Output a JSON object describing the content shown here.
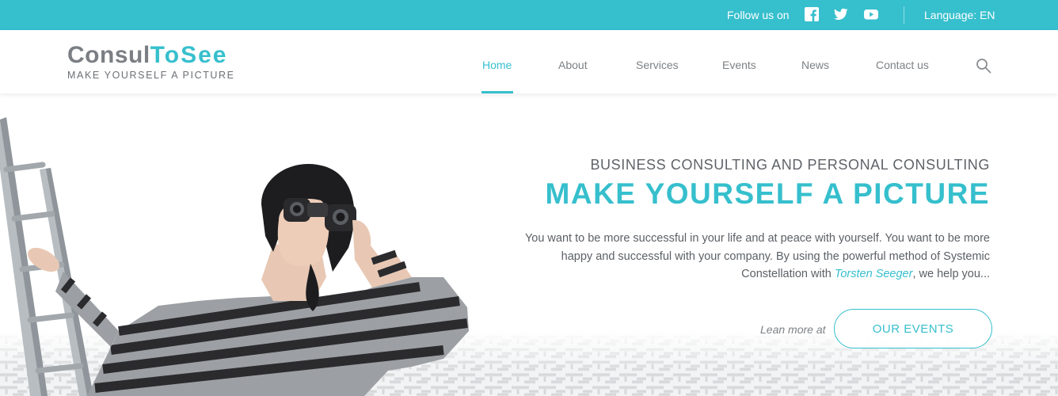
{
  "topbar": {
    "follow_label": "Follow us on",
    "social": [
      {
        "name": "facebook-icon"
      },
      {
        "name": "twitter-icon"
      },
      {
        "name": "youtube-icon"
      }
    ],
    "language_label": "Language: EN"
  },
  "logo": {
    "part1": "Consul",
    "part2": "ToSee",
    "tagline": "MAKE YOURSELF A PICTURE"
  },
  "nav": {
    "items": [
      {
        "label": "Home",
        "active": true
      },
      {
        "label": "About"
      },
      {
        "label": "Services"
      },
      {
        "label": "Events"
      },
      {
        "label": "News"
      },
      {
        "label": "Contact us"
      }
    ],
    "search_icon": "search-icon"
  },
  "hero": {
    "subtitle": "BUSINESS CONSULTING AND PERSONAL CONSULTING",
    "headline": "MAKE YOURSELF A PICTURE",
    "body_before": "You want to be more successful in your life and at peace with yourself. You want to be more happy and successful with your company. By using the powerful method of Systemic Constellation with ",
    "body_person": "Torsten Seeger",
    "body_after": ", we help you...",
    "learn_label": "Lean more at",
    "cta_label": "OUR EVENTS"
  },
  "colors": {
    "accent": "#36bfcd",
    "text": "#5c6065"
  }
}
